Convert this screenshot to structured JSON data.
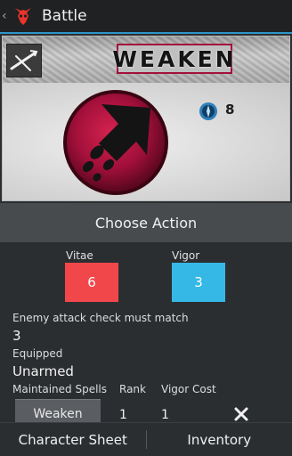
{
  "actionbar": {
    "title": "Battle",
    "back_icon": "chevron-left-icon",
    "app_icon": "demon-skull-icon"
  },
  "card": {
    "spell_name": "WEAKEN",
    "class_icon": "crossed-blade-icon",
    "orb_icon": "rising-arrow-orb-icon",
    "cost_icon": "vigor-crest-icon",
    "cost_value": "8"
  },
  "choose_action": "Choose Action",
  "stats": {
    "vitae_label": "Vitae",
    "vitae_value": "6",
    "vitae_color": "#f2474a",
    "vigor_label": "Vigor",
    "vigor_value": "3",
    "vigor_color": "#35b8e6"
  },
  "enemy_check_label": "Enemy attack check must match",
  "enemy_check_value": "3",
  "equipped_label": "Equipped",
  "equipped_value": "Unarmed",
  "maintained": {
    "headers": [
      "Maintained Spells",
      "Rank",
      "Vigor Cost"
    ],
    "rows": [
      {
        "spell": "Weaken",
        "rank": "1",
        "cost": "1"
      }
    ],
    "remove_icon": "close-icon"
  },
  "tabs": [
    "Character Sheet",
    "Inventory"
  ]
}
